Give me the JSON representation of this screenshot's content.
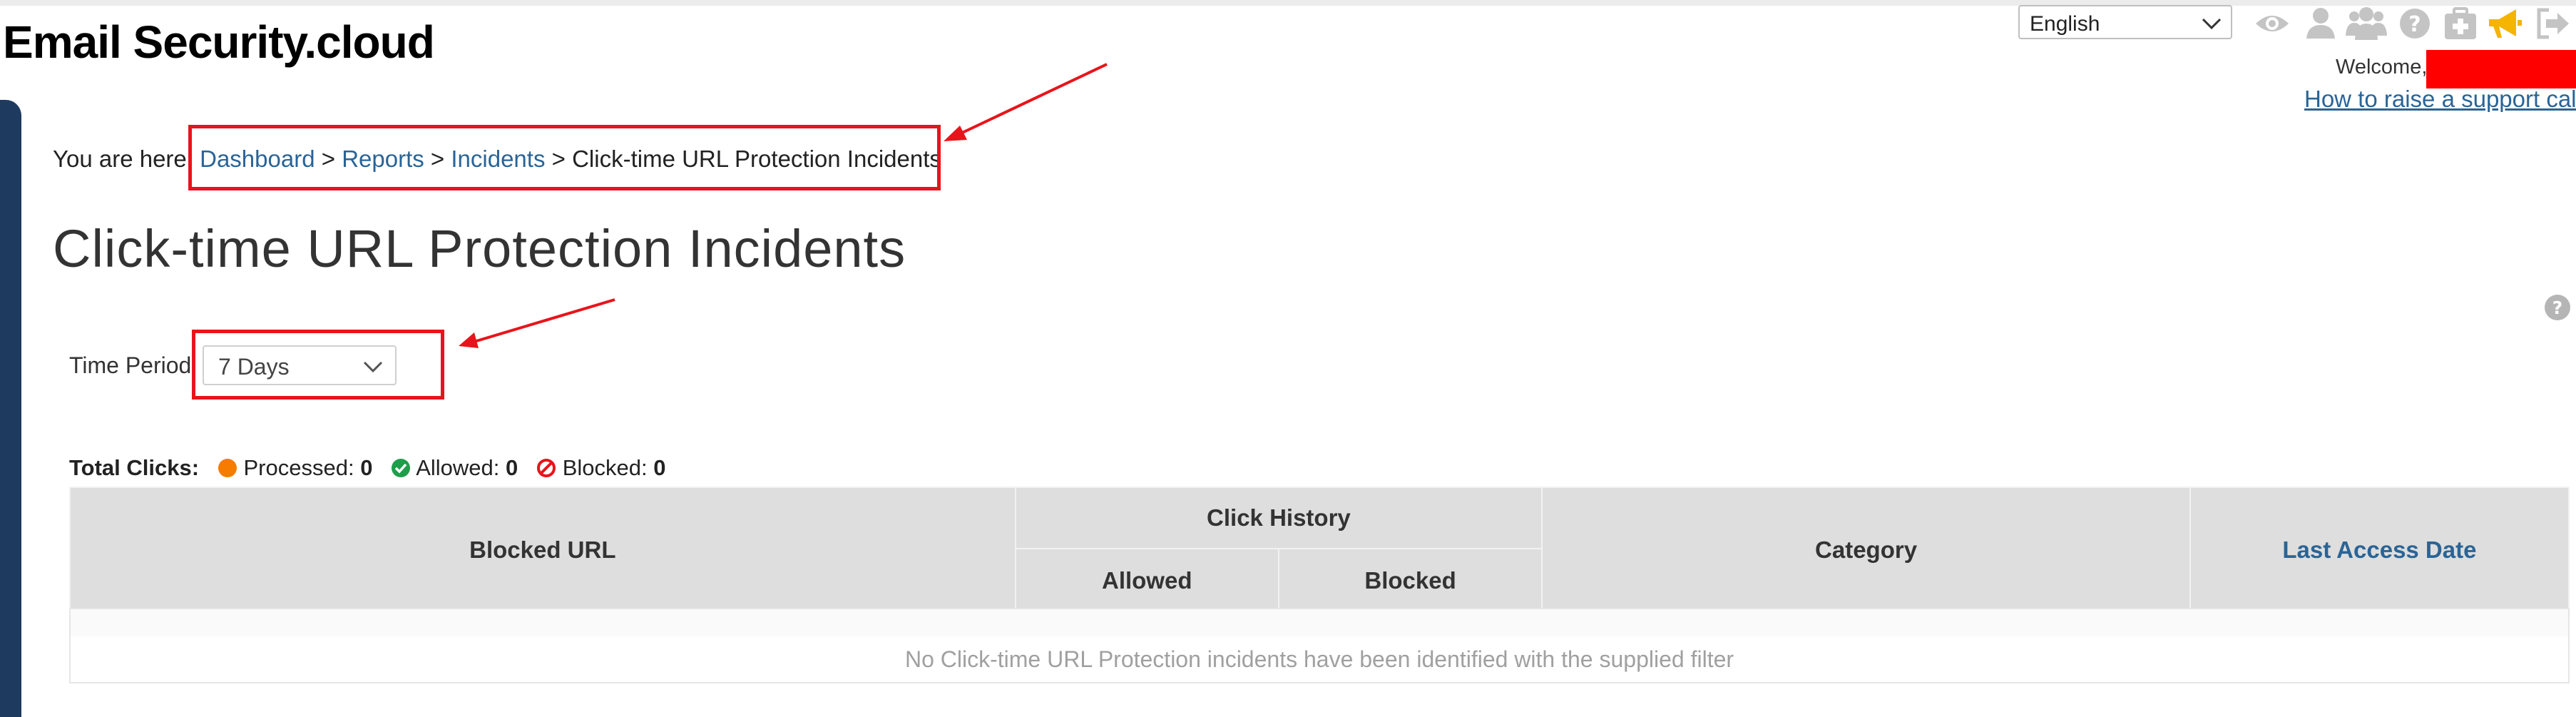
{
  "app": {
    "logo_text": "Email Security.cloud"
  },
  "header": {
    "language": "English",
    "welcome_label": "Welcome,",
    "support_link": "How to raise a support call",
    "icons": [
      "eye-icon",
      "user-icon",
      "users-icon",
      "help-icon",
      "medical-kit-icon",
      "megaphone-icon",
      "logout-icon"
    ]
  },
  "breadcrumb": {
    "prefix": "You are here:",
    "items": [
      "Dashboard",
      "Reports",
      "Incidents"
    ],
    "separator": ">",
    "current": "Click-time URL Protection Incidents"
  },
  "page": {
    "title": "Click-time URL Protection Incidents"
  },
  "filter": {
    "time_period_label": "Time Period",
    "time_period_value": "7 Days"
  },
  "totals": {
    "label": "Total Clicks:",
    "processed_label": "Processed:",
    "processed_value": "0",
    "allowed_label": "Allowed:",
    "allowed_value": "0",
    "blocked_label": "Blocked:",
    "blocked_value": "0"
  },
  "table": {
    "columns": {
      "blocked_url": "Blocked URL",
      "click_history": "Click History",
      "allowed": "Allowed",
      "blocked": "Blocked",
      "category": "Category",
      "last_access_date": "Last Access Date"
    },
    "empty_message": "No Click-time URL Protection incidents have been identified with the supplied filter"
  },
  "colors": {
    "accent_link": "#2a6496",
    "annotation_red": "#e8141b",
    "processed": "#f57c00",
    "allowed": "#1e9e4a",
    "blocked": "#e8141b",
    "sidebar": "#1e3a5f"
  }
}
